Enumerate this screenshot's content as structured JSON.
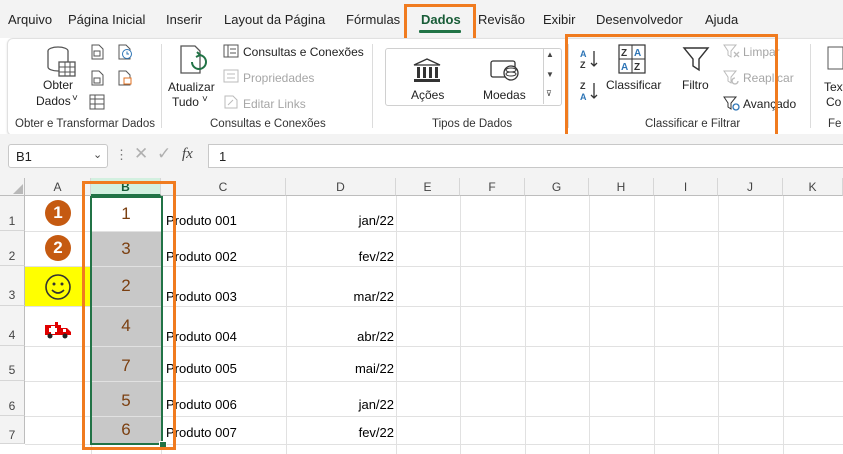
{
  "tabs": [
    "Arquivo",
    "Página Inicial",
    "Inserir",
    "Layout da Página",
    "Fórmulas",
    "Dados",
    "Revisão",
    "Exibir",
    "Desenvolvedor",
    "Ajuda"
  ],
  "active_tab": "Dados",
  "ribbon": {
    "get_data": {
      "line1": "Obter",
      "line2": "Dados",
      "chevron": "˅"
    },
    "refresh_all": {
      "line1": "Atualizar",
      "line2": "Tudo",
      "chevron": "˅"
    },
    "queries": {
      "connections": "Consultas e Conexões",
      "properties": "Propriedades",
      "edit_links": "Editar Links"
    },
    "data_types": {
      "stocks": "Ações",
      "currencies": "Moedas"
    },
    "sort": {
      "sort_label": "Classificar",
      "filter": "Filtro",
      "clear": "Limpar",
      "reapply": "Reaplicar",
      "advanced": "Avançado"
    },
    "text_cut": "Text",
    "text_cut2": "Co",
    "fe_cut": "Fe",
    "groups": {
      "get_transform": "Obter e Transformar Dados",
      "queries_connections": "Consultas e Conexões",
      "data_types": "Tipos de Dados",
      "sort_filter": "Classificar e Filtrar"
    }
  },
  "formula_bar": {
    "name_box": "B1",
    "fx": "fx",
    "value": "1"
  },
  "grid": {
    "columns": [
      "A",
      "B",
      "C",
      "D",
      "E",
      "F",
      "G",
      "H",
      "I",
      "J",
      "K"
    ],
    "rows": [
      {
        "num": "1",
        "a": "1",
        "b": "1",
        "c": "Produto 001",
        "d": "jan/22"
      },
      {
        "num": "2",
        "a": "2",
        "b": "3",
        "c": "Produto 002",
        "d": "fev/22"
      },
      {
        "num": "3",
        "a": "smiley-face",
        "b": "2",
        "c": "Produto 003",
        "d": "mar/22"
      },
      {
        "num": "4",
        "a": "ambulance",
        "b": "4",
        "c": "Produto 004",
        "d": "abr/22"
      },
      {
        "num": "5",
        "a": "",
        "b": "7",
        "c": "Produto 005",
        "d": "mai/22"
      },
      {
        "num": "6",
        "a": "",
        "b": "5",
        "c": "Produto 006",
        "d": "jan/22"
      },
      {
        "num": "7",
        "a": "",
        "b": "6",
        "c": "Produto 007",
        "d": "fev/22"
      }
    ]
  },
  "colors": {
    "accent": "#217346",
    "highlight": "#f07b1f",
    "circle": "#c55a11",
    "yellow": "#ffff00"
  }
}
